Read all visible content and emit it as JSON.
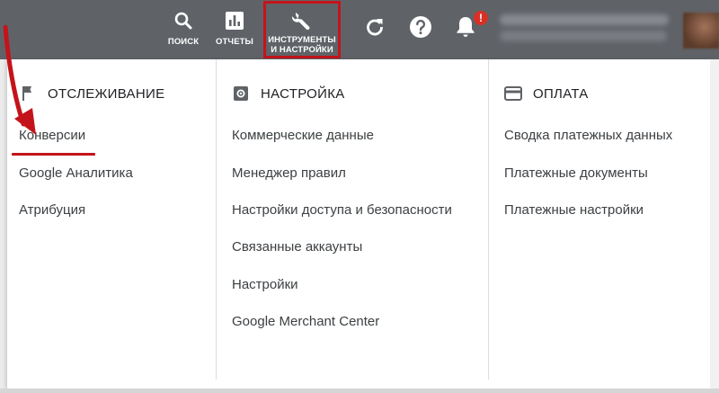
{
  "toolbar": {
    "search_label": "ПОИСК",
    "reports_label": "ОТЧЕТЫ",
    "tools_label_line1": "ИНСТРУМЕНТЫ",
    "tools_label_line2": "И НАСТРОЙКИ",
    "notification_badge": "!",
    "icons": {
      "search": "search-icon",
      "reports": "bar-chart-icon",
      "tools": "wrench-icon",
      "refresh": "refresh-icon",
      "help": "help-icon",
      "notifications": "bell-icon"
    }
  },
  "menu": {
    "tracking": {
      "title": "ОТСЛЕЖИВАНИЕ",
      "icon": "flag-icon",
      "items": [
        "Конверсии",
        "Google Аналитика",
        "Атрибуция"
      ]
    },
    "setup": {
      "title": "НАСТРОЙКА",
      "icon": "settings-icon",
      "items": [
        "Коммерческие данные",
        "Менеджер правил",
        "Настройки доступа и безопасности",
        "Связанные аккаунты",
        "Настройки",
        "Google Merchant Center"
      ]
    },
    "billing": {
      "title": "ОПЛАТА",
      "icon": "credit-card-icon",
      "items": [
        "Сводка платежных данных",
        "Платежные документы",
        "Платежные настройки"
      ]
    }
  },
  "colors": {
    "toolbar_bg": "#5f6368",
    "highlight_red": "#c4141b",
    "badge_red": "#d93025",
    "text_primary": "#202124",
    "text_item": "#3c4043"
  }
}
